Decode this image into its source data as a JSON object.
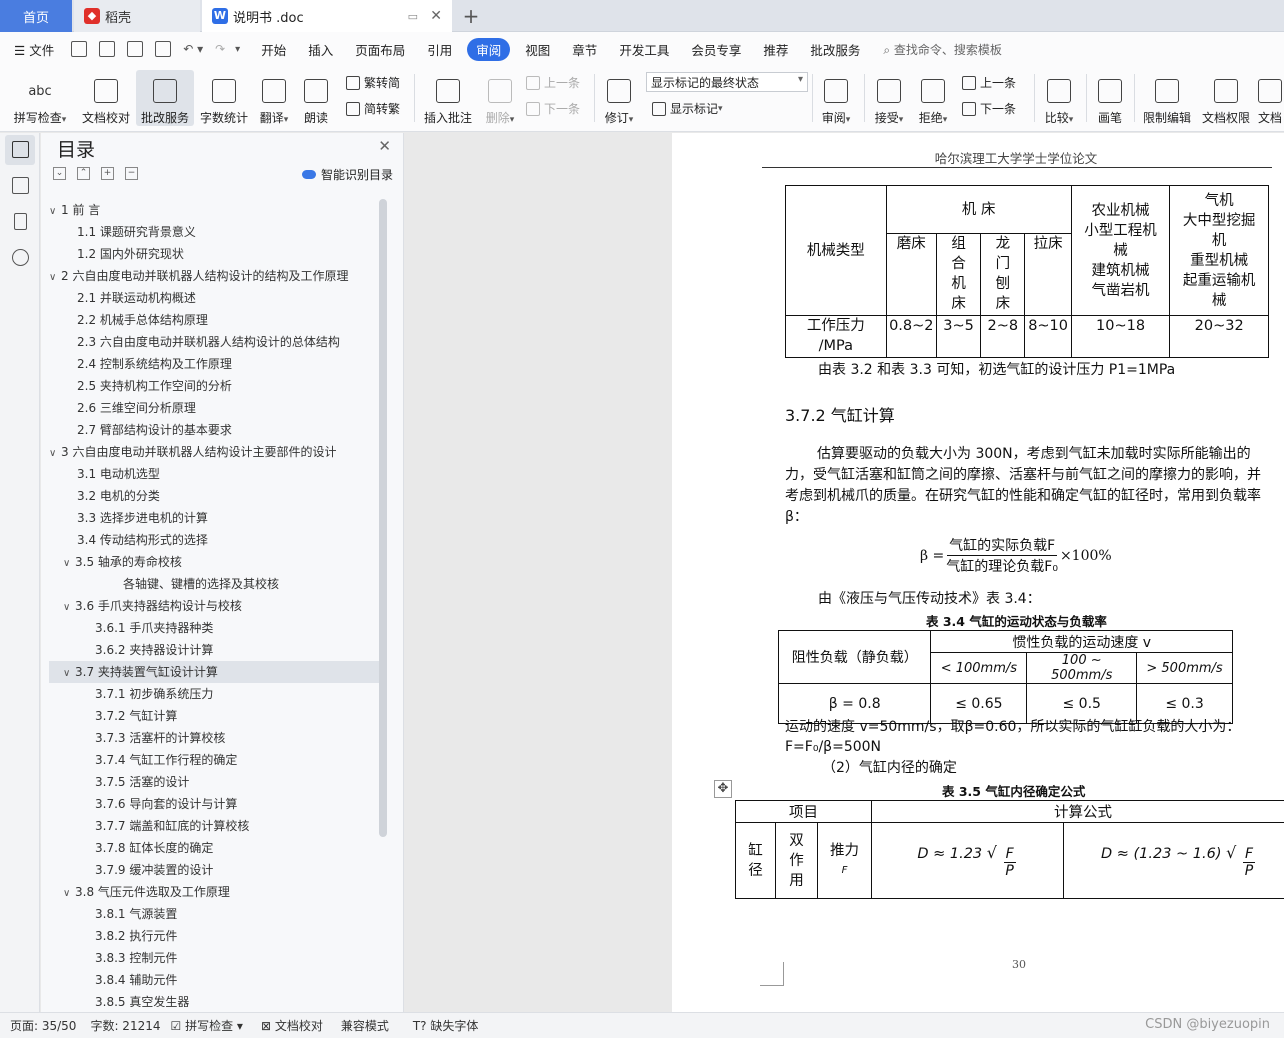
{
  "tabs": {
    "home": "首页",
    "daoke": "稻壳",
    "doc": "说明书 .doc",
    "plus": "+"
  },
  "menu": {
    "file": "文件",
    "items": [
      "开始",
      "插入",
      "页面布局",
      "引用",
      "审阅",
      "视图",
      "章节",
      "开发工具",
      "会员专享",
      "推荐",
      "批改服务"
    ],
    "active": "审阅",
    "search": "查找命令、搜索模板"
  },
  "ribbon": {
    "spellcheck": "拼写检查",
    "doccheck": "文档校对",
    "correction": "批改服务",
    "wordcount": "字数统计",
    "translate": "翻译",
    "read": "朗读",
    "trad": "繁转简",
    "simp": "简转繁",
    "insert_comment": "插入批注",
    "delete": "删除",
    "prev": "上一条",
    "next": "下一条",
    "track": "修订",
    "markup_state": "显示标记的最终状态",
    "show_markup": "显示标记",
    "review": "审阅",
    "accept": "接受",
    "reject": "拒绝",
    "prev2": "上一条",
    "next2": "下一条",
    "compare": "比较",
    "pen": "画笔",
    "restrict": "限制编辑",
    "permission": "文档权限",
    "doc_cut": "文档"
  },
  "toc": {
    "title": "目录",
    "smart": "智能识别目录",
    "items": [
      {
        "label": "1   前 言",
        "level": 1,
        "arrow": "∨"
      },
      {
        "label": "1.1  课题研究背景意义",
        "level": 2
      },
      {
        "label": "1.2  国内外研究现状",
        "level": 2
      },
      {
        "label": "2   六自由度电动并联机器人结构设计的结构及工作原理",
        "level": 1,
        "arrow": "∨"
      },
      {
        "label": "2.1  并联运动机构概述",
        "level": 2
      },
      {
        "label": "2.2  机械手总体结构原理",
        "level": 2
      },
      {
        "label": "2.3 六自由度电动并联机器人结构设计的总体结构",
        "level": 2
      },
      {
        "label": "2.4  控制系统结构及工作原理",
        "level": 2
      },
      {
        "label": "2.5  夹持机构工作空间的分析",
        "level": 2
      },
      {
        "label": "2.6 三维空间分析原理",
        "level": 2
      },
      {
        "label": "2.7  臂部结构设计的基本要求",
        "level": 2
      },
      {
        "label": "3   六自由度电动并联机器人结构设计主要部件的设计",
        "level": 1,
        "arrow": "∨"
      },
      {
        "label": "3.1  电动机选型",
        "level": 2
      },
      {
        "label": "3.2 电机的分类",
        "level": 2
      },
      {
        "label": "3.3 选择步进电机的计算",
        "level": 2
      },
      {
        "label": "3.4 传动结构形式的选择",
        "level": 2
      },
      {
        "label": "3.5  轴承的寿命校核",
        "level": 2,
        "arrow": "∨"
      },
      {
        "label": "各轴键、键槽的选择及其校核",
        "level": 4
      },
      {
        "label": "3.6  手爪夹持器结构设计与校核",
        "level": 2,
        "arrow": "∨"
      },
      {
        "label": "3.6.1 手爪夹持器种类",
        "level": 3
      },
      {
        "label": "3.6.2 夹持器设计计算",
        "level": 3
      },
      {
        "label": "3.7  夹持装置气缸设计计算",
        "level": 2,
        "arrow": "∨",
        "selected": true
      },
      {
        "label": "3.7.1  初步确系统压力",
        "level": 3
      },
      {
        "label": "3.7.2 气缸计算",
        "level": 3
      },
      {
        "label": "3.7.3  活塞杆的计算校核",
        "level": 3
      },
      {
        "label": "3.7.4  气缸工作行程的确定",
        "level": 3
      },
      {
        "label": "3.7.5  活塞的设计",
        "level": 3
      },
      {
        "label": "3.7.6  导向套的设计与计算",
        "level": 3
      },
      {
        "label": "3.7.7  端盖和缸底的计算校核",
        "level": 3
      },
      {
        "label": "3.7.8  缸体长度的确定",
        "level": 3
      },
      {
        "label": "3.7.9  缓冲装置的设计",
        "level": 3
      },
      {
        "label": "3.8  气压元件选取及工作原理",
        "level": 2,
        "arrow": "∨"
      },
      {
        "label": "3.8.1  气源装置",
        "level": 3
      },
      {
        "label": "3.8.2  执行元件",
        "level": 3
      },
      {
        "label": "3.8.3  控制元件",
        "level": 3
      },
      {
        "label": "3.8.4  辅助元件",
        "level": 3
      },
      {
        "label": "3.8.5  真空发生器",
        "level": 3
      }
    ]
  },
  "doc": {
    "header": "哈尔滨理工大学学士学位论文",
    "table1": {
      "col_type": "机械类型",
      "machine": "机 床",
      "agri": "农业机械\n小型工程机\n械\n建筑机械\n气凿岩机",
      "heavy": "气机\n大中型挖掘\n机\n重型机械\n起重运输机\n械",
      "grind": "磨床",
      "combo": "组\n合\n机\n床",
      "gantry": "龙\n门\n刨\n床",
      "broach": "拉床",
      "pressure_label": "工作压力\n/MPa",
      "v1": "0.8~2",
      "v2": "3~5",
      "v3": "2~8",
      "v4": "8~10",
      "v5": "10~18",
      "v6": "20~32"
    },
    "p1": "由表 3.2 和表 3.3 可知，初选气缸的设计压力 P1=1MPa",
    "h372": "3.7.2 气缸计算",
    "p2": "估算要驱动的负载大小为 300N，考虑到气缸未加载时实际所能输出的力，受气缸活塞和缸筒之间的摩擦、活塞杆与前气缸之间的摩擦力的影响，并考虑到机械爪的质量。在研究气缸的性能和确定气缸的缸径时，常用到负载率β：",
    "formula_beta": "β =",
    "formula_num": "气缸的实际负载F",
    "formula_den": "气缸的理论负载F₀",
    "formula_tail": "×100%",
    "p3": "由《液压与气压传动技术》表 3.4：",
    "cap34": "表 3.4  气缸的运动状态与负载率",
    "table2": {
      "static": "阻性负载（静负载）",
      "inertia": "惯性负载的运动速度 v",
      "s1": "< 100mm/s",
      "s2": "100 ~ 500mm/s",
      "s3": "> 500mm/s",
      "beta": "β = 0.8",
      "r1": "≤ 0.65",
      "r2": "≤ 0.5",
      "r3": "≤ 0.3"
    },
    "p4": "运动的速度 v=50mm/s，取β=0.60，所以实际的气缸缸负载的大小为：",
    "p5": "F=F₀/β=500N",
    "p6": "（2）气缸内径的确定",
    "cap35": "表 3.5   气缸内径确定公式",
    "table3": {
      "item": "项目",
      "formula": "计算公式",
      "bore": "缸\n径",
      "double": "双\n作\n用",
      "thrust": "推力",
      "fpm": "F",
      "f1": "D ≈ 1.23",
      "f2": "D ≈ (1.23 ~ 1.6)",
      "rad_num": "F",
      "rad_den": "P"
    },
    "page_num": "30"
  },
  "status": {
    "page": "页面: 35/50",
    "words": "字数: 21214",
    "spell": "拼写检查",
    "proof": "文档校对",
    "compat": "兼容模式",
    "missing_font": "缺失字体"
  },
  "watermark": "CSDN @biyezuopin"
}
